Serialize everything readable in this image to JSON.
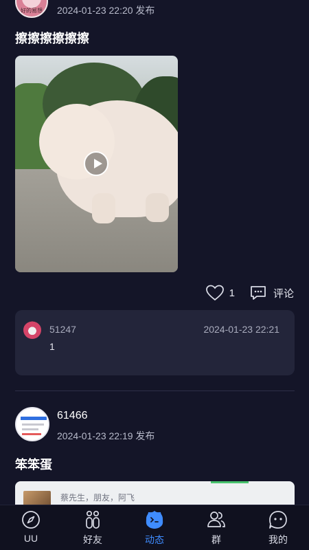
{
  "post1": {
    "avatar_caption": "好的易想",
    "timestamp": "2024-01-23 22:20 发布",
    "title": "擦擦擦擦擦擦",
    "likes": "1",
    "comment_label": "评论",
    "comments": [
      {
        "username": "51247",
        "timestamp": "2024-01-23 22:21",
        "text": "1"
      }
    ]
  },
  "post2": {
    "username": "61466",
    "timestamp": "2024-01-23 22:19 发布",
    "title": "笨笨蛋",
    "shared_names": "蔡先生，朋友，阿飞"
  },
  "tabbar": {
    "active": "动态",
    "items": [
      {
        "label": "UU",
        "icon": "compass-icon"
      },
      {
        "label": "好友",
        "icon": "friends-icon"
      },
      {
        "label": "动态",
        "icon": "feed-icon"
      },
      {
        "label": "群",
        "icon": "group-icon"
      },
      {
        "label": "我的",
        "icon": "profile-icon"
      }
    ]
  },
  "colors": {
    "background": "#141528",
    "card": "#23253a",
    "accent": "#3f8cff",
    "text_muted": "#b8bbcb"
  }
}
